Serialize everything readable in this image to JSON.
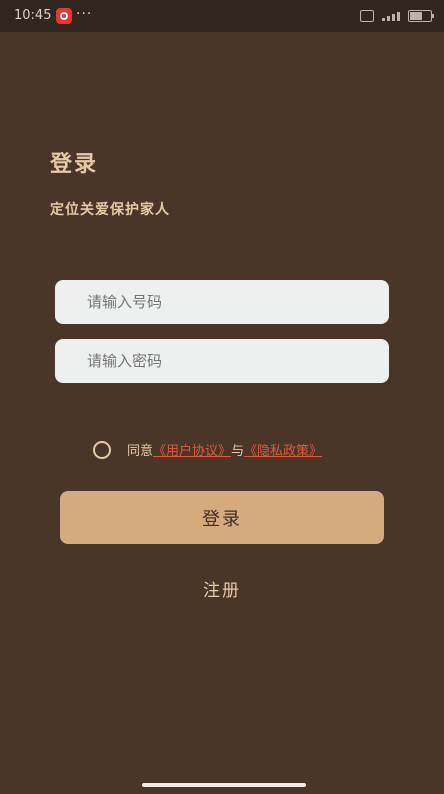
{
  "status_bar": {
    "time": "10:45",
    "dots": "···",
    "battery_level": 0.6
  },
  "login": {
    "title": "登录",
    "subtitle": "定位关爱保护家人",
    "phone_placeholder": "请输入号码",
    "password_placeholder": "请输入密码",
    "agree_prefix": "同意",
    "user_agreement": "《用户协议》",
    "and": "与",
    "privacy_policy": "《隐私政策》",
    "login_button": "登录",
    "register_link": "注册"
  },
  "colors": {
    "background": "#4a3628",
    "accent": "#d5aa7d",
    "link": "#e8573a",
    "text": "#e6caa8"
  }
}
